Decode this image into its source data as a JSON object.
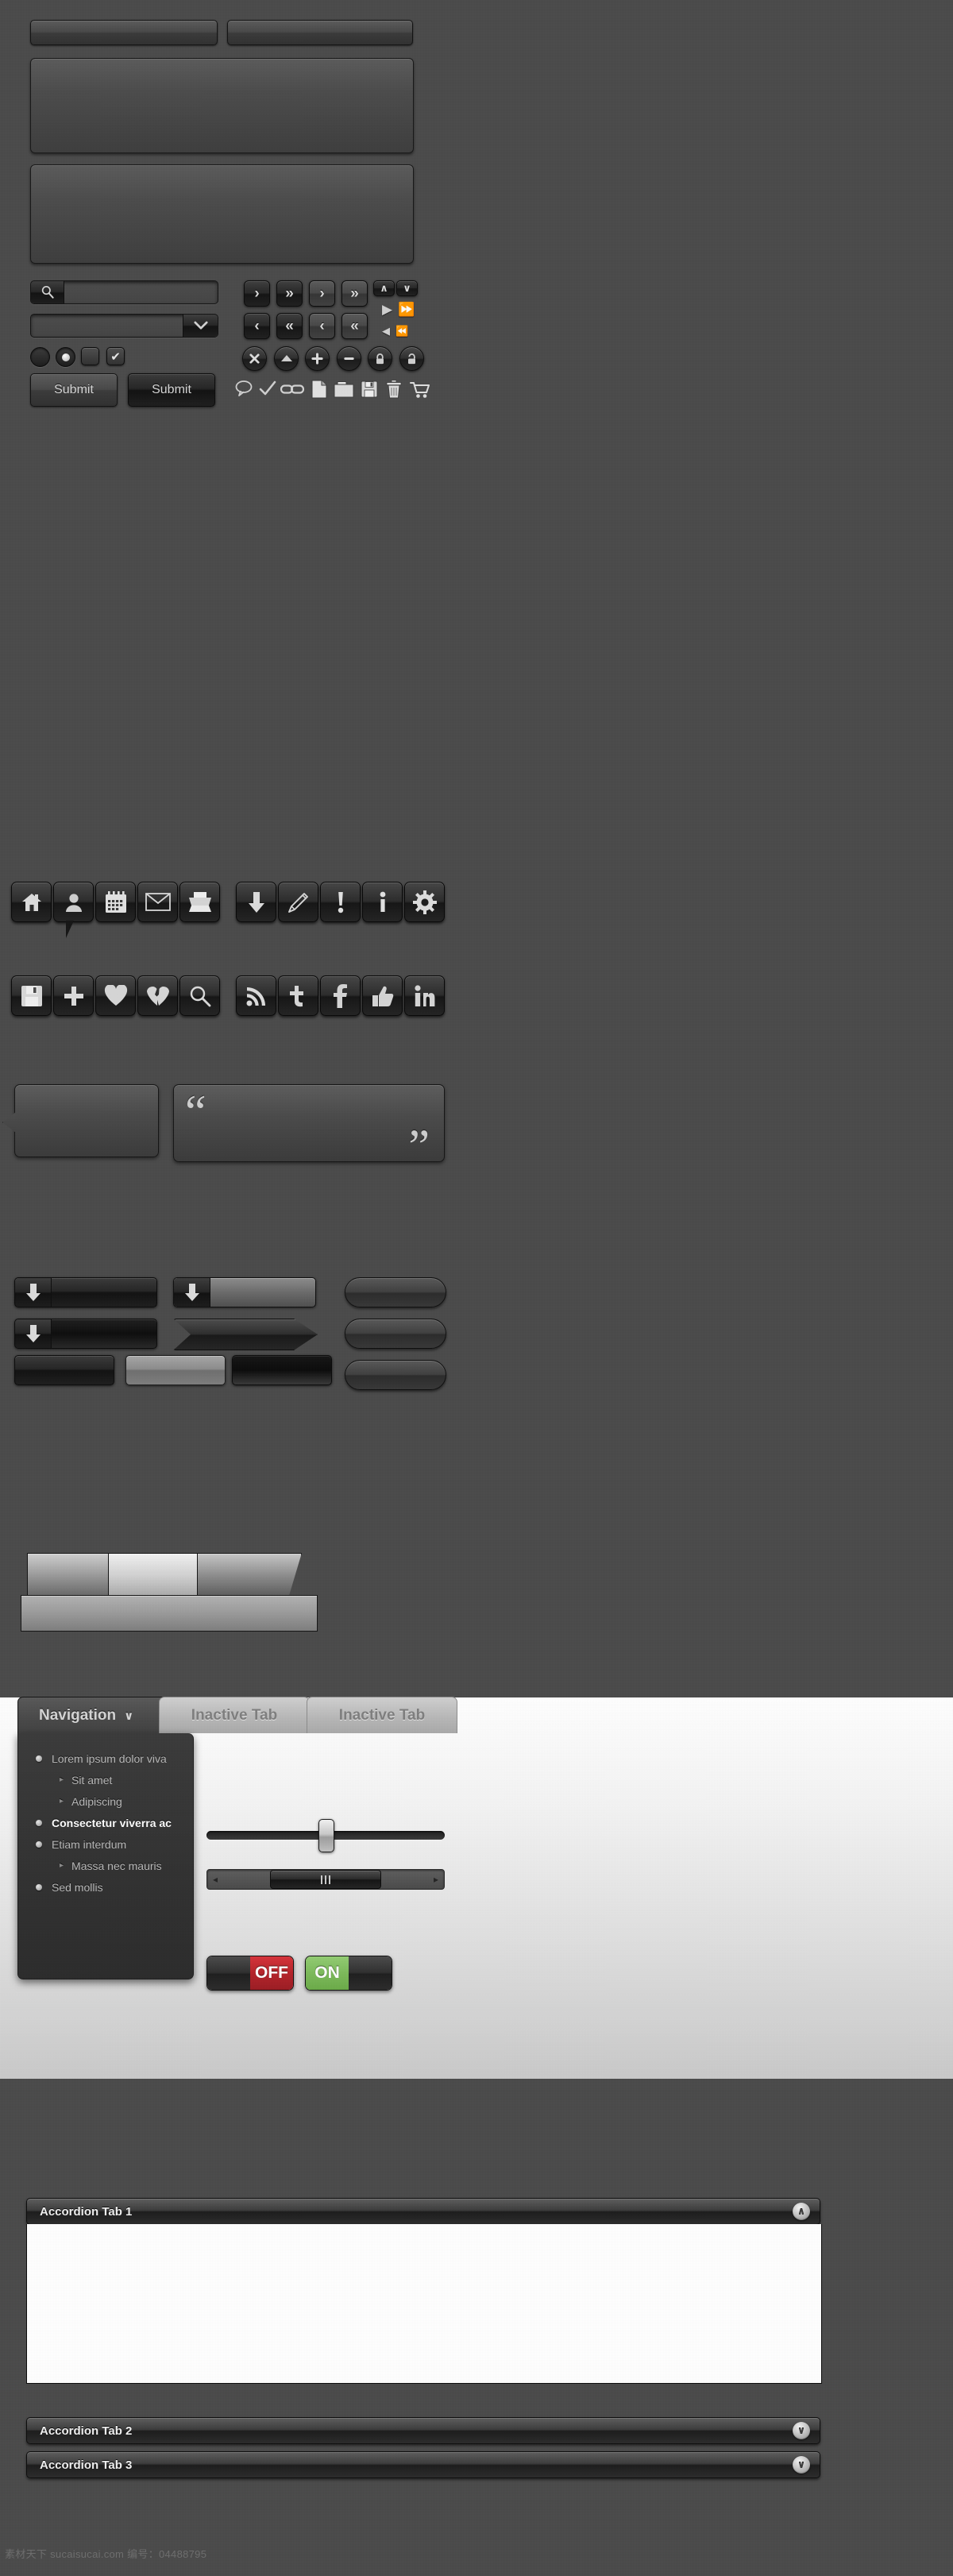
{
  "meta": {
    "background_color": "#4a4a4a"
  },
  "form": {
    "text_input_left": {
      "value": "",
      "placeholder": ""
    },
    "text_input_right": {
      "value": "",
      "placeholder": ""
    },
    "textarea_1": {
      "value": "",
      "placeholder": ""
    },
    "textarea_2": {
      "value": "",
      "placeholder": ""
    },
    "search": {
      "value": "",
      "placeholder": "",
      "icon": "search-icon"
    },
    "select": {
      "value": "",
      "arrow_icon": "chevron-down-icon"
    },
    "radio_unchecked_label": "",
    "radio_checked_label": "",
    "checkbox_unchecked_label": "",
    "checkbox_checked_label": "",
    "checkbox_check_glyph": "✔",
    "submit_light_label": "Submit",
    "submit_dark_label": "Submit"
  },
  "pagination": {
    "dark_buttons": [
      {
        "name": "next-button",
        "glyph": "›"
      },
      {
        "name": "fast-forward-button",
        "glyph": "»"
      }
    ],
    "light_buttons": [
      {
        "name": "next-button-light",
        "glyph": "›"
      },
      {
        "name": "fast-forward-button-light",
        "glyph": "»"
      }
    ],
    "dark_buttons_back": [
      {
        "name": "prev-button",
        "glyph": "‹"
      },
      {
        "name": "rewind-button",
        "glyph": "«"
      }
    ],
    "light_buttons_back": [
      {
        "name": "prev-button-light",
        "glyph": "‹"
      },
      {
        "name": "rewind-button-light",
        "glyph": "«"
      }
    ],
    "small_buttons": [
      {
        "name": "scroll-up-button",
        "glyph": "∧"
      },
      {
        "name": "scroll-down-button",
        "glyph": "∨"
      }
    ],
    "plain_arrows": [
      {
        "name": "play-arrow-icon",
        "glyph": "▶"
      },
      {
        "name": "double-play-arrow-icon",
        "glyph": "⏩"
      },
      {
        "name": "back-arrow-icon",
        "glyph": "◀"
      },
      {
        "name": "double-back-arrow-icon",
        "glyph": "⏪"
      }
    ]
  },
  "circle_buttons": [
    {
      "name": "close-button",
      "icon": "x-icon"
    },
    {
      "name": "collapse-button",
      "icon": "triangle-up-icon"
    },
    {
      "name": "add-button",
      "icon": "plus-icon"
    },
    {
      "name": "remove-button",
      "icon": "minus-icon"
    },
    {
      "name": "lock-button",
      "icon": "lock-closed-icon"
    },
    {
      "name": "unlock-button",
      "icon": "lock-open-icon"
    }
  ],
  "mono_icons": [
    {
      "name": "comment-icon"
    },
    {
      "name": "check-icon"
    },
    {
      "name": "link-icon"
    },
    {
      "name": "document-icon"
    },
    {
      "name": "folder-icon"
    },
    {
      "name": "save-icon"
    },
    {
      "name": "trash-icon"
    },
    {
      "name": "cart-icon"
    }
  ],
  "icon_buttons_row_1": [
    {
      "name": "home-icon-button",
      "icon": "home-icon"
    },
    {
      "name": "user-icon-button",
      "icon": "user-pin-icon"
    },
    {
      "name": "calendar-icon-button",
      "icon": "calendar-icon"
    },
    {
      "name": "mail-icon-button",
      "icon": "envelope-icon"
    },
    {
      "name": "print-icon-button",
      "icon": "printer-icon"
    },
    {
      "name": "download-icon-button",
      "icon": "download-arrow-icon"
    },
    {
      "name": "edit-icon-button",
      "icon": "pencil-icon"
    },
    {
      "name": "alert-icon-button",
      "icon": "exclamation-icon"
    },
    {
      "name": "info-icon-button",
      "icon": "info-icon"
    },
    {
      "name": "settings-icon-button",
      "icon": "gear-icon"
    }
  ],
  "icon_buttons_row_2": [
    {
      "name": "save-icon-button",
      "icon": "floppy-icon"
    },
    {
      "name": "add-icon-button",
      "icon": "plus-icon"
    },
    {
      "name": "favorite-icon-button",
      "icon": "heart-icon"
    },
    {
      "name": "unfavorite-icon-button",
      "icon": "broken-heart-icon"
    },
    {
      "name": "search-icon-button",
      "icon": "magnifier-icon"
    },
    {
      "name": "rss-icon-button",
      "icon": "rss-icon"
    },
    {
      "name": "twitter-icon-button",
      "icon": "twitter-icon"
    },
    {
      "name": "facebook-icon-button",
      "icon": "facebook-icon"
    },
    {
      "name": "like-icon-button",
      "icon": "thumbs-up-icon"
    },
    {
      "name": "linkedin-icon-button",
      "icon": "linkedin-icon"
    }
  ],
  "callout": {
    "text": ""
  },
  "blockquote": {
    "text": "",
    "open_quote": "“",
    "close_quote": "”"
  },
  "download_bars": [
    {
      "name": "download-bar-dark",
      "label": "",
      "icon": "download-arrow-icon"
    },
    {
      "name": "download-bar-light",
      "label": "",
      "icon": "download-arrow-icon"
    },
    {
      "name": "download-bar-deep",
      "label": "",
      "icon": "download-arrow-icon"
    },
    {
      "name": "ribbon-bar",
      "label": ""
    }
  ],
  "pill_buttons": [
    {
      "name": "pill-button-1",
      "label": ""
    },
    {
      "name": "pill-button-2",
      "label": ""
    },
    {
      "name": "pill-button-3",
      "label": ""
    }
  ],
  "style_buttons": [
    {
      "name": "button-style-dark",
      "label": ""
    },
    {
      "name": "button-style-light",
      "label": ""
    },
    {
      "name": "button-style-black",
      "label": ""
    },
    {
      "name": "button-style-rounded",
      "label": ""
    }
  ],
  "breadcrumb": {
    "steps": [
      {
        "name": "breadcrumb-step-1",
        "label": ""
      },
      {
        "name": "breadcrumb-step-2",
        "label": ""
      },
      {
        "name": "breadcrumb-step-3",
        "label": ""
      }
    ]
  },
  "tabs": [
    {
      "name": "tab-navigation",
      "label": "Navigation",
      "state": "active",
      "caret": "∨"
    },
    {
      "name": "tab-inactive-1",
      "label": "Inactive Tab",
      "state": "inactive"
    },
    {
      "name": "tab-inactive-2",
      "label": "Inactive Tab",
      "state": "inactive"
    }
  ],
  "nav_menu": {
    "items": [
      {
        "label": "Lorem ipsum dolor viva",
        "level": 1,
        "current": false
      },
      {
        "label": "Sit amet",
        "level": 2,
        "current": false
      },
      {
        "label": "Adipiscing",
        "level": 2,
        "current": false
      },
      {
        "label": "Consectetur viverra ac",
        "level": 1,
        "current": true
      },
      {
        "label": "Etiam interdum",
        "level": 1,
        "current": false
      },
      {
        "label": "Massa nec mauris",
        "level": 2,
        "current": false
      },
      {
        "label": "Sed mollis",
        "level": 1,
        "current": false
      }
    ],
    "sub_caret": "▸"
  },
  "slider": {
    "name": "range-slider",
    "value_percent": 50
  },
  "scrollbar": {
    "name": "horizontal-scrollbar",
    "left_arrow": "◂",
    "right_arrow": "▸",
    "thumb_position_percent": 50
  },
  "toggles": [
    {
      "name": "toggle-off",
      "label": "OFF",
      "state": "off",
      "color": "#b52229"
    },
    {
      "name": "toggle-on",
      "label": "ON",
      "state": "on",
      "color": "#7cba5a"
    }
  ],
  "accordion": [
    {
      "name": "accordion-tab-1",
      "label": "Accordion Tab 1",
      "expanded": true,
      "caret": "∧"
    },
    {
      "name": "accordion-tab-2",
      "label": "Accordion Tab 2",
      "expanded": false,
      "caret": "∨"
    },
    {
      "name": "accordion-tab-3",
      "label": "Accordion Tab 3",
      "expanded": false,
      "caret": "∨"
    }
  ],
  "footer": {
    "watermark": "素材天下 sucaisucai.com  编号：04488795"
  }
}
